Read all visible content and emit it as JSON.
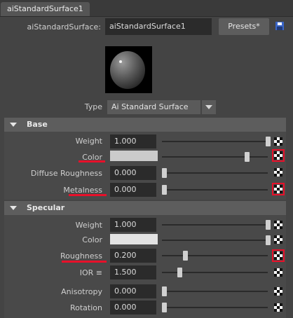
{
  "tab": {
    "title": "aiStandardSurface1"
  },
  "header": {
    "label": "aiStandardSurface:",
    "node_name": "aiStandardSurface1",
    "presets_label": "Presets*"
  },
  "type": {
    "label": "Type",
    "value": "Ai Standard Surface"
  },
  "base": {
    "title": "Base",
    "weight": {
      "label": "Weight",
      "value": "1.000",
      "slider": 1.0
    },
    "color": {
      "label": "Color",
      "swatch": "#cbcbcb",
      "slider": 0.8
    },
    "diffuse_roughness": {
      "label": "Diffuse Roughness",
      "value": "0.000",
      "slider": 0.0
    },
    "metalness": {
      "label": "Metalness",
      "value": "0.000",
      "slider": 0.0
    }
  },
  "specular": {
    "title": "Specular",
    "weight": {
      "label": "Weight",
      "value": "1.000",
      "slider": 1.0
    },
    "color": {
      "label": "Color",
      "swatch": "#e2e2e2",
      "slider": 1.0
    },
    "roughness": {
      "label": "Roughness",
      "value": "0.200",
      "slider": 0.2
    },
    "ior": {
      "label": "IOR ≡",
      "value": "1.500"
    },
    "anisotropy": {
      "label": "Anisotropy",
      "value": "0.000",
      "slider": 0.0
    },
    "rotation": {
      "label": "Rotation",
      "value": "0.000",
      "slider": 0.0
    }
  },
  "colors": {
    "highlight": "#e8102a",
    "background": "#444444"
  },
  "icons": {
    "map_button": "checker-map-icon",
    "save": "save-preset-icon",
    "expand": "section-collapse-arrow-icon"
  }
}
